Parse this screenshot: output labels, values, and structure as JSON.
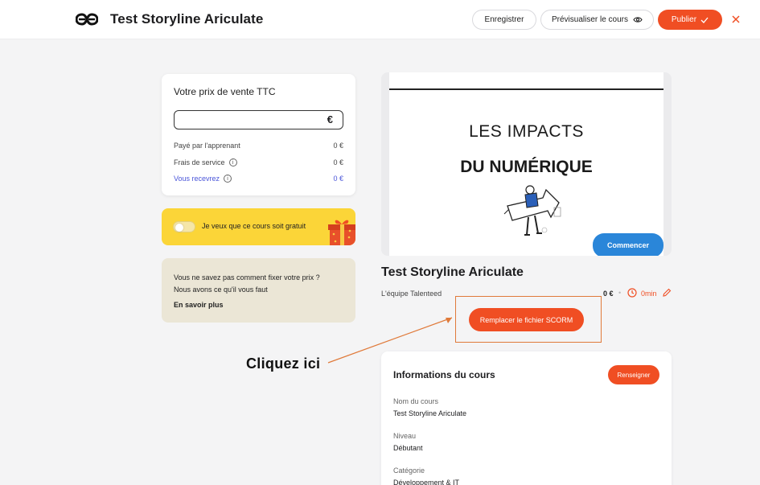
{
  "header": {
    "app_title": "Test Storyline Ariculate",
    "save_label": "Enregistrer",
    "preview_label": "Prévisualiser le cours",
    "publish_label": "Publier",
    "accent_color": "#f04e23"
  },
  "pricing": {
    "title": "Votre prix de vente TTC",
    "input_value": "",
    "currency": "€",
    "rows": [
      {
        "label": "Payé par l'apprenant",
        "value": "0 €"
      },
      {
        "label": "Frais de service",
        "value": "0 €"
      },
      {
        "label": "Vous recevrez",
        "value": "0 €"
      }
    ]
  },
  "free_option": {
    "label": "Je veux que ce cours soit gratuit",
    "enabled": false
  },
  "help": {
    "text_line1": "Vous ne savez pas comment fixer votre prix ?",
    "text_line2": "Nous avons ce qu'il vous faut",
    "link": "En savoir plus"
  },
  "preview": {
    "line1": "LES IMPACTS",
    "line2": "DU NUMÉRIQUE",
    "start_button": "Commencer"
  },
  "course": {
    "title": "Test Storyline Ariculate",
    "team": "L'équipe Talenteed",
    "price": "0 €",
    "separator": "•",
    "duration": "0min",
    "replace_scorm_button": "Remplacer le fichier SCORM"
  },
  "annotation": {
    "callout": "Cliquez ici",
    "color": "#e07a3a"
  },
  "course_info": {
    "heading": "Informations du cours",
    "action_button": "Renseigner",
    "fields": [
      {
        "label": "Nom du cours",
        "value": "Test Storyline Ariculate"
      },
      {
        "label": "Niveau",
        "value": "Débutant"
      },
      {
        "label": "Catégorie",
        "value": "Développement & IT"
      }
    ]
  }
}
